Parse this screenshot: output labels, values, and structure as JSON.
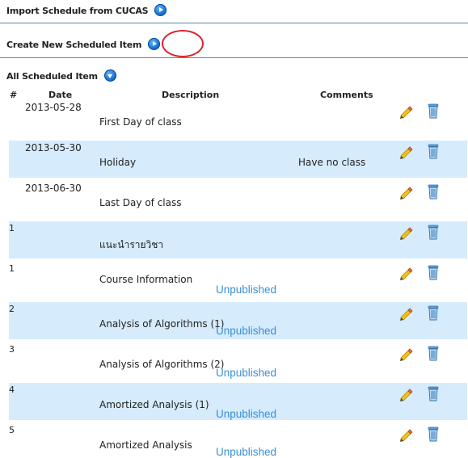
{
  "links": {
    "import_label": "Import Schedule from CUCAS",
    "create_label": "Create New Scheduled Item",
    "all_label": "All Scheduled Item"
  },
  "table": {
    "headers": [
      "#",
      "Date",
      "Description",
      "Comments"
    ],
    "rows": [
      {
        "num": "",
        "date": "2013-05-28",
        "desc": "First Day of class",
        "comment": "",
        "status": ""
      },
      {
        "num": "",
        "date": "2013-05-30",
        "desc": "Holiday",
        "comment": "Have no class",
        "status": ""
      },
      {
        "num": "",
        "date": "2013-06-30",
        "desc": "Last Day of class",
        "comment": "",
        "status": ""
      },
      {
        "num": "1",
        "date": "",
        "desc": "แนะนำรายวิชา",
        "comment": "",
        "status": ""
      },
      {
        "num": "1",
        "date": "",
        "desc": "Course Information",
        "comment": "",
        "status": "Unpublished"
      },
      {
        "num": "2",
        "date": "",
        "desc": "Analysis of Algorithms (1)",
        "comment": "",
        "status": "Unpublished"
      },
      {
        "num": "3",
        "date": "",
        "desc": "Analysis of Algorithms (2)",
        "comment": "",
        "status": "Unpublished"
      },
      {
        "num": "4",
        "date": "",
        "desc": "Amortized Analysis (1)",
        "comment": "",
        "status": "Unpublished"
      },
      {
        "num": "5",
        "date": "",
        "desc": "Amortized Analysis",
        "comment": "",
        "status": "Unpublished"
      }
    ]
  },
  "icons": {
    "import": "play-circle-icon",
    "create": "play-circle-icon",
    "all": "expand-circle-icon",
    "edit": "pencil-icon",
    "delete": "trash-icon"
  },
  "colors": {
    "accent_blue": "#0b63c9",
    "row_alt_bg": "#d6ebfb",
    "status_text": "#3a8fd8",
    "annotation_red": "#d9232a"
  }
}
